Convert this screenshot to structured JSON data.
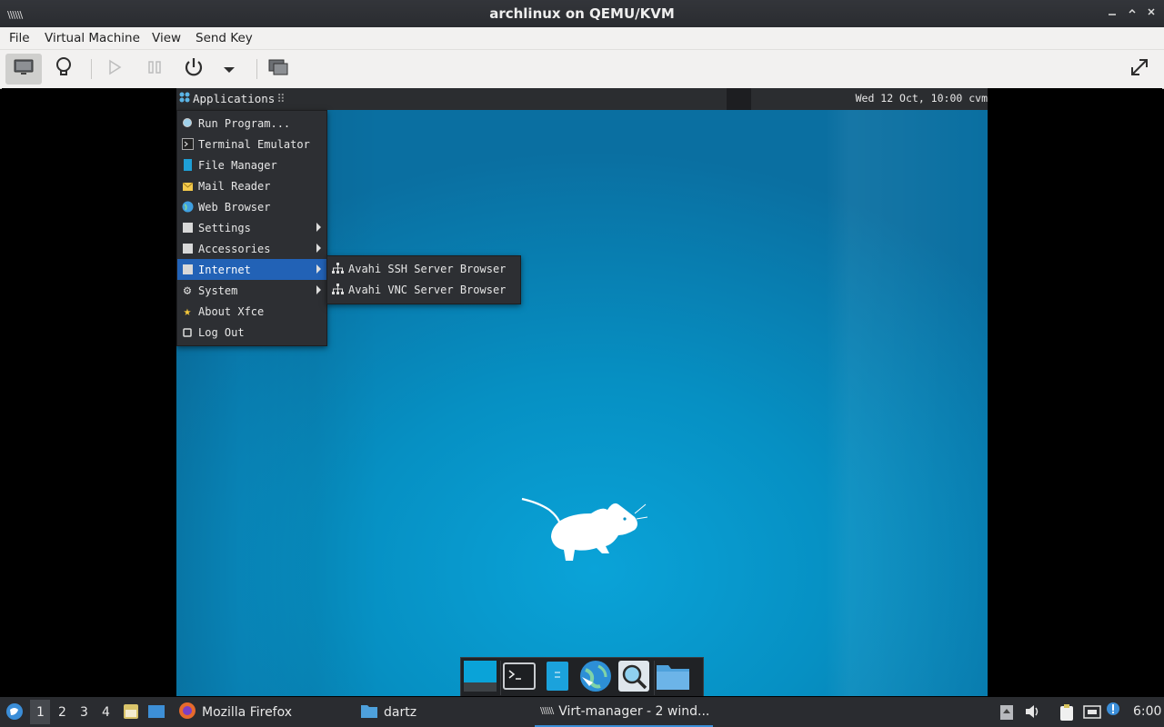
{
  "window": {
    "title": "archlinux on QEMU/KVM",
    "controls": [
      "minimize-icon",
      "maximize-icon",
      "close-icon"
    ]
  },
  "menubar": {
    "items": [
      "File",
      "Virtual Machine",
      "View",
      "Send Key"
    ]
  },
  "toolbar": {
    "buttons": [
      "console-icon",
      "lightbulb-icon",
      "play-icon",
      "pause-icon",
      "power-icon",
      "dropdown-arrow-icon",
      "screenshot-icon",
      "fullscreen-icon"
    ]
  },
  "guest": {
    "panel": {
      "apps_label": "Applications",
      "clock": "Wed 12 Oct, 10:00  cvm"
    },
    "app_menu": {
      "items": [
        {
          "label": "Run Program...",
          "icon": "search-icon"
        },
        {
          "label": "Terminal Emulator",
          "icon": "terminal-icon"
        },
        {
          "label": "File Manager",
          "icon": "file-manager-icon"
        },
        {
          "label": "Mail Reader",
          "icon": "mail-icon"
        },
        {
          "label": "Web Browser",
          "icon": "globe-icon"
        },
        {
          "label": "Settings",
          "icon": "settings-icon",
          "submenu": true
        },
        {
          "label": "Accessories",
          "icon": "accessories-icon",
          "submenu": true
        },
        {
          "label": "Internet",
          "icon": "internet-icon",
          "submenu": true,
          "highlighted": true
        },
        {
          "label": "System",
          "icon": "gear-icon",
          "submenu": true
        },
        {
          "label": "About Xfce",
          "icon": "star-icon"
        },
        {
          "label": "Log Out",
          "icon": "logout-icon"
        }
      ]
    },
    "internet_submenu": {
      "items": [
        {
          "label": "Avahi SSH Server Browser",
          "icon": "network-icon"
        },
        {
          "label": "Avahi VNC Server Browser",
          "icon": "network-icon"
        }
      ]
    },
    "dock": [
      "show-desktop-icon",
      "terminal-icon",
      "files-icon",
      "web-browser-icon",
      "app-finder-icon",
      "folder-icon"
    ]
  },
  "host_panel": {
    "workspaces": [
      "1",
      "2",
      "3",
      "4"
    ],
    "active_workspace": "1",
    "tasks": [
      {
        "label": "Mozilla Firefox",
        "icon": "firefox-icon"
      },
      {
        "label": "dartz",
        "icon": "folder-icon"
      },
      {
        "label": "Virt-manager - 2 wind...",
        "icon": "virt-manager-icon",
        "active": true
      }
    ],
    "tray": [
      "notification-icon",
      "volume-icon",
      "clipboard-icon",
      "network-icon",
      "updates-icon"
    ],
    "clock": "6:00"
  },
  "colors": {
    "desktop": "#0690c3",
    "menu_highlight": "#2262b6",
    "panel": "#2a2c30"
  }
}
